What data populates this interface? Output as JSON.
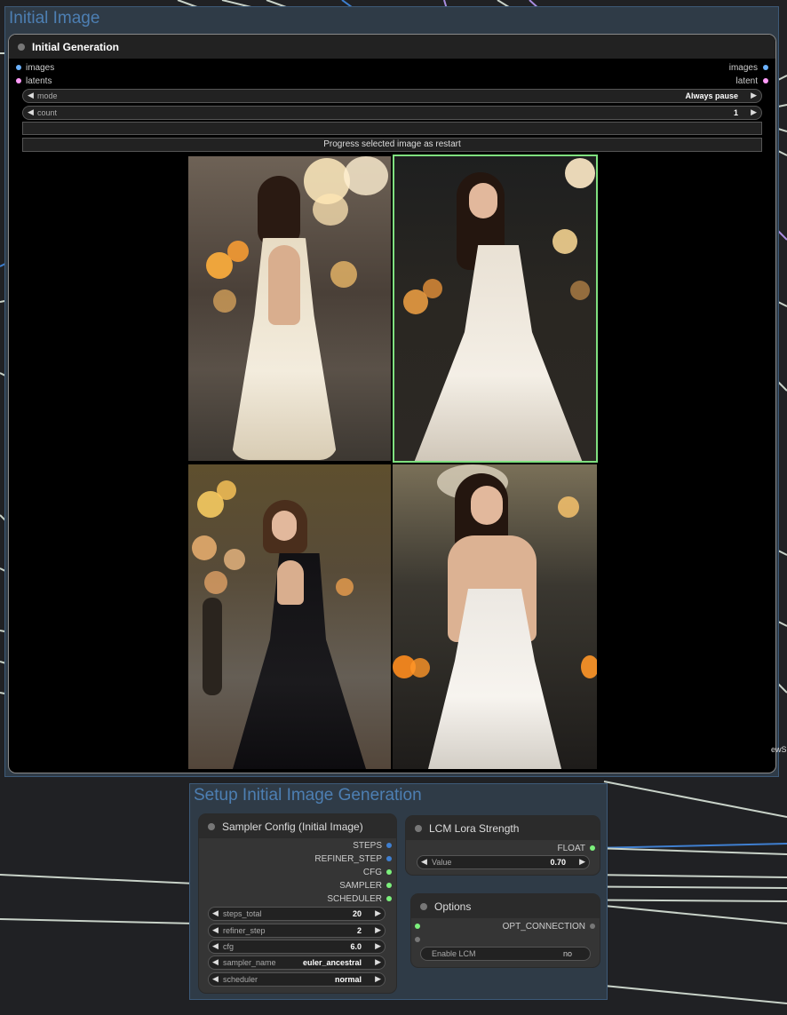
{
  "groups": {
    "initial": {
      "title": "Initial Image"
    },
    "setup": {
      "title": "Setup Initial Image Generation"
    }
  },
  "initial_node": {
    "title": "Initial Generation",
    "inputs": [
      "images",
      "latents"
    ],
    "outputs": [
      "images",
      "latent"
    ],
    "mode": {
      "label": "mode",
      "value": "Always pause"
    },
    "count": {
      "label": "count",
      "value": "1"
    },
    "text_input_value": "",
    "button_label": "Progress selected image as restart",
    "selected_image_index": 1,
    "images": [
      {
        "name": "woman-cream-dress-back"
      },
      {
        "name": "woman-white-dress-turned"
      },
      {
        "name": "woman-black-dress-back"
      },
      {
        "name": "woman-white-slip-dress"
      }
    ]
  },
  "sampler_node": {
    "title": "Sampler Config (Initial Image)",
    "outputs": [
      "STEPS",
      "REFINER_STEP",
      "CFG",
      "SAMPLER",
      "SCHEDULER"
    ],
    "widgets": [
      {
        "label": "steps_total",
        "value": "20"
      },
      {
        "label": "refiner_step",
        "value": "2"
      },
      {
        "label": "cfg",
        "value": "6.0"
      },
      {
        "label": "sampler_name",
        "value": "euler_ancestral"
      },
      {
        "label": "scheduler",
        "value": "normal"
      }
    ]
  },
  "lcm_node": {
    "title": "LCM Lora Strength",
    "output": "FLOAT",
    "widget": {
      "label": "Value",
      "value": "0.70"
    }
  },
  "options_node": {
    "title": "Options",
    "output": "OPT_CONNECTION",
    "toggle": {
      "label": "Enable LCM",
      "value": "no"
    }
  },
  "edge_fragment": "ewS",
  "colors": {
    "images_slot": "#6cb3ff",
    "latent_slot": "#ff9cf9",
    "int_slot": "#3f7fd0",
    "green_slot": "#7cf07c",
    "selected_border": "#7fe07f"
  }
}
